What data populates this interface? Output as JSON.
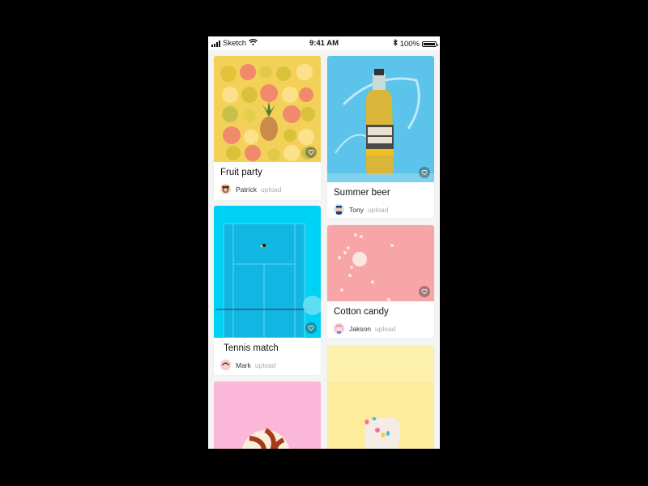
{
  "status_bar": {
    "carrier": "Sketch",
    "time": "9:41 AM",
    "battery": "100%"
  },
  "cards": [
    {
      "title": "Fruit party",
      "user": "Patrick",
      "action": "upload",
      "image": "citrus-fruit-slices-and-pineapple-on-yellow"
    },
    {
      "title": "Summer beer",
      "user": "Tony",
      "action": "upload",
      "image": "ginger-beer-bottle-with-splash-on-blue"
    },
    {
      "title": "Tennis match",
      "user": "Mark",
      "action": "upload",
      "image": "aerial-tennis-court-blue"
    },
    {
      "title": "Cotton candy",
      "user": "Jakson",
      "action": "upload",
      "image": "pink-candy-on-pink-background"
    },
    {
      "title": "",
      "user": "",
      "action": "",
      "image": "lollipop-on-pink"
    },
    {
      "title": "",
      "user": "",
      "action": "",
      "image": "hand-with-painted-nails-on-yellow"
    }
  ],
  "colors": {
    "fruit_bg": "#f3d159",
    "beer_bg": "#5cc3ea",
    "tennis_bg": "#00d2f5",
    "candy_bg": "#f8a5a8",
    "lollipop_bg": "#fbb7d8",
    "nails_bg": "#fcec9c"
  }
}
